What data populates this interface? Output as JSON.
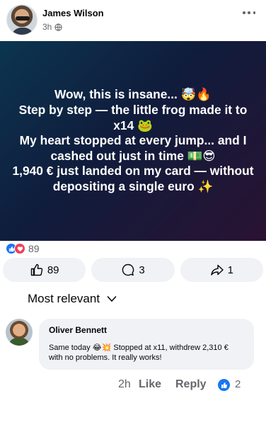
{
  "post": {
    "author": "James Wilson",
    "time": "3h",
    "text": "Wow, this is insane... 🤯🔥\nStep by step — the little frog made it to x14 🐸\nMy heart stopped at every jump... and I cashed out just in time 💵😎\n1,940 € just landed on my card — without depositing a single euro ✨",
    "background_colors": [
      "#0b3550",
      "#101c3c",
      "#2a1232"
    ]
  },
  "reactions": {
    "count": "89"
  },
  "actions": {
    "like_count": "89",
    "comment_count": "3",
    "share_count": "1"
  },
  "comments_sort": {
    "label": "Most relevant"
  },
  "comment": {
    "author": "Oliver Bennett",
    "text": "Same today 😂💥 Stopped at x11, withdrew 2,310 € with no problems. It really works!",
    "time": "2h",
    "like_label": "Like",
    "reply_label": "Reply",
    "like_count": "2"
  },
  "colors": {
    "accent": "#1877f2",
    "love": "#f33e58",
    "muted": "#65676b",
    "surface": "#f0f2f5"
  }
}
